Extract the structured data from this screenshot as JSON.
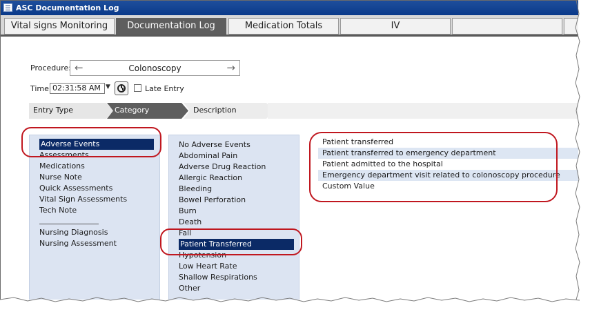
{
  "window": {
    "title": "ASC Documentation Log"
  },
  "tabs": [
    {
      "label": "Vital signs Monitoring"
    },
    {
      "label": "Documentation Log"
    },
    {
      "label": "Medication Totals"
    },
    {
      "label": "IV"
    },
    {
      "label": ""
    },
    {
      "label": ""
    }
  ],
  "procedure": {
    "label": "Procedure:",
    "value": "Colonoscopy"
  },
  "time": {
    "label": "Time:",
    "value": "02:31:58 AM",
    "late_entry_label": "Late Entry"
  },
  "breadcrumb": [
    "Entry Type",
    "Category",
    "Description"
  ],
  "entry_types": {
    "items": [
      "Adverse Events",
      "Assessments",
      "Medications",
      "Nurse Note",
      "Quick Assessments",
      "Vital Sign Assessments",
      "Tech Note"
    ],
    "items2": [
      "Nursing Diagnosis",
      "Nursing Assessment"
    ],
    "selected": "Adverse Events"
  },
  "categories": {
    "items": [
      "No Adverse Events",
      "Abdominal Pain",
      "Adverse Drug Reaction",
      "Allergic Reaction",
      "Bleeding",
      "Bowel Perforation",
      "Burn",
      "Death",
      "Fall",
      "Patient Transferred",
      "Hypotension",
      "Low Heart Rate",
      "Shallow Respirations",
      "Other"
    ],
    "selected": "Patient Transferred"
  },
  "descriptions": {
    "items": [
      "Patient transferred",
      "Patient transferred to emergency department",
      "Patient admitted to the hospital",
      "Emergency department visit related to colonoscopy procedure",
      "Custom Value"
    ]
  },
  "colors": {
    "title_bar": "#0a3a8a",
    "selection": "#0b2a66",
    "annotation": "#c0171f",
    "panel": "#dce4f2"
  }
}
